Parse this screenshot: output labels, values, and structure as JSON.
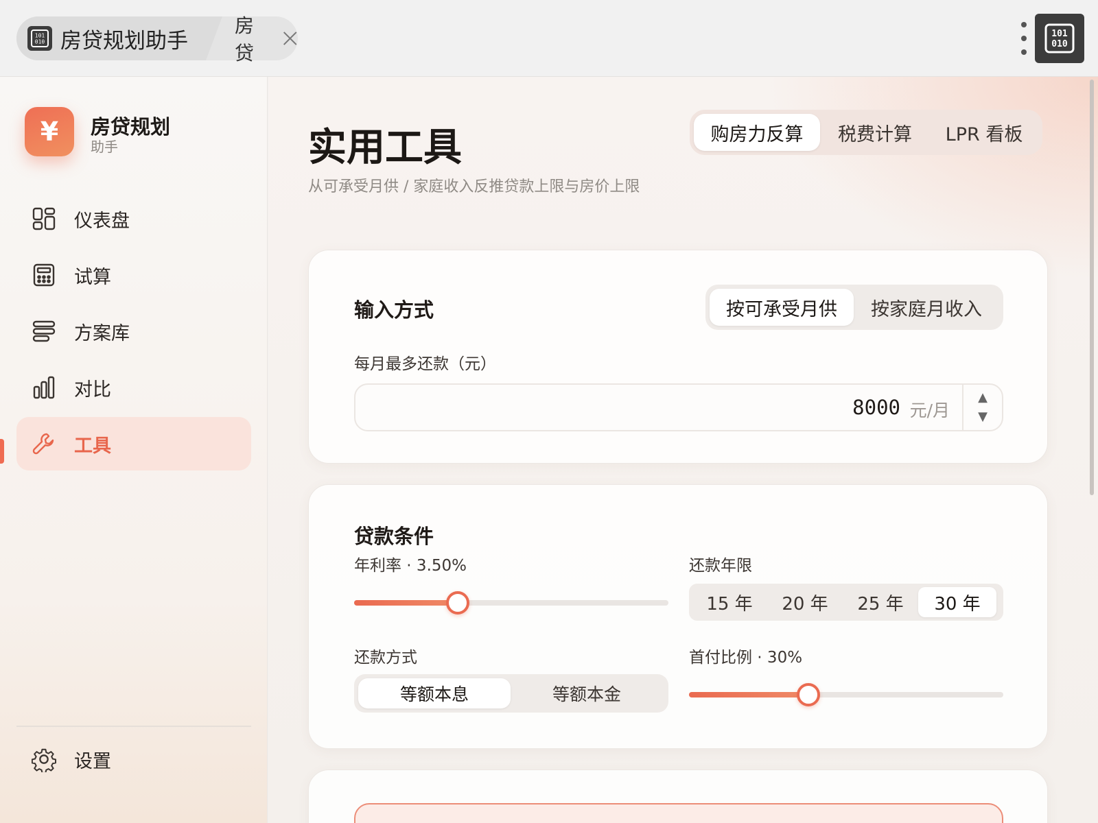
{
  "titlebar": {
    "tab_title": "房贷规划助手",
    "tab_second": "房贷"
  },
  "sidebar": {
    "brand_name": "房贷规划",
    "brand_sub": "助手",
    "brand_symbol": "¥",
    "items": [
      {
        "label": "仪表盘",
        "icon": "dashboard-icon"
      },
      {
        "label": "试算",
        "icon": "calculator-icon"
      },
      {
        "label": "方案库",
        "icon": "stack-icon"
      },
      {
        "label": "对比",
        "icon": "bar-chart-icon"
      },
      {
        "label": "工具",
        "icon": "wrench-icon",
        "active": true
      }
    ],
    "settings_label": "设置"
  },
  "main": {
    "title": "实用工具",
    "subtitle": "从可承受月供 / 家庭收入反推贷款上限与房价上限",
    "tabs": [
      {
        "label": "购房力反算",
        "active": true
      },
      {
        "label": "税费计算"
      },
      {
        "label": "LPR 看板"
      }
    ],
    "input_card": {
      "title": "输入方式",
      "modes": [
        {
          "label": "按可承受月供",
          "active": true
        },
        {
          "label": "按家庭月收入"
        }
      ],
      "field_label": "每月最多还款（元）",
      "value": "8000",
      "unit": "元/月",
      "stepper_up": "▲",
      "stepper_down": "▼"
    },
    "loan_card": {
      "title": "贷款条件",
      "rate_label": "年利率 · 3.50%",
      "rate_level_pct": 33,
      "term_label": "还款年限",
      "terms": [
        {
          "label": "15 年"
        },
        {
          "label": "20 年"
        },
        {
          "label": "25 年"
        },
        {
          "label": "30 年",
          "active": true
        }
      ],
      "method_label": "还款方式",
      "methods": [
        {
          "label": "等额本息",
          "active": true
        },
        {
          "label": "等额本金"
        }
      ],
      "down_label": "首付比例 · 30%",
      "down_level_pct": 38
    }
  },
  "colors": {
    "accent": "#ea6a50",
    "active_nav_bg": "#fae3dc"
  }
}
